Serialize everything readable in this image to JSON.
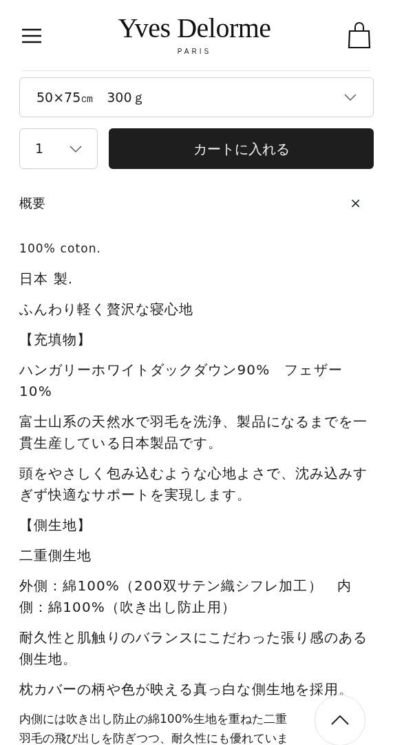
{
  "header": {
    "logo": "Yves Delorme",
    "logo_sub": "PARIS"
  },
  "variant_select": {
    "value": "50×75㎝　300ｇ"
  },
  "quantity_select": {
    "value": "1"
  },
  "add_to_cart": "カートに入れる",
  "section": {
    "title": "概要",
    "toggle": "×",
    "paragraphs": [
      {
        "kind": "small",
        "text": "100% coton."
      },
      {
        "kind": "body",
        "text": "日本 製."
      },
      {
        "kind": "body",
        "text": "ふんわり軽く贅沢な寝心地"
      },
      {
        "kind": "body",
        "text": "【充填物】"
      },
      {
        "kind": "body",
        "text": "ハンガリーホワイトダックダウン90%　フェザー10%"
      },
      {
        "kind": "body",
        "text": "富士山系の天然水で羽毛を洗浄、製品になるまでを一貫生産している日本製品です。"
      },
      {
        "kind": "body",
        "text": "頭をやさしく包み込むような心地よさで、沈み込みすぎず快適なサポートを実現します。"
      },
      {
        "kind": "body",
        "text": "【側生地】"
      },
      {
        "kind": "body",
        "text": "二重側生地"
      },
      {
        "kind": "body",
        "text": "外側：綿100%（200双サテン織シフレ加工）　内側：綿100%（吹き出し防止用）"
      },
      {
        "kind": "body",
        "text": "耐久性と肌触りのバランスにこだわった張り感のある側生地。"
      },
      {
        "kind": "body",
        "text": "枕カバーの柄や色が映える真っ白な側生地を採用。"
      },
      {
        "kind": "clipped",
        "text": "内側には吹き出し防止の綿100%生地を重ねた二重"
      },
      {
        "kind": "clipped",
        "text": "羽毛の飛び出しを防ぎつつ、耐久性にも優れていま"
      }
    ]
  }
}
